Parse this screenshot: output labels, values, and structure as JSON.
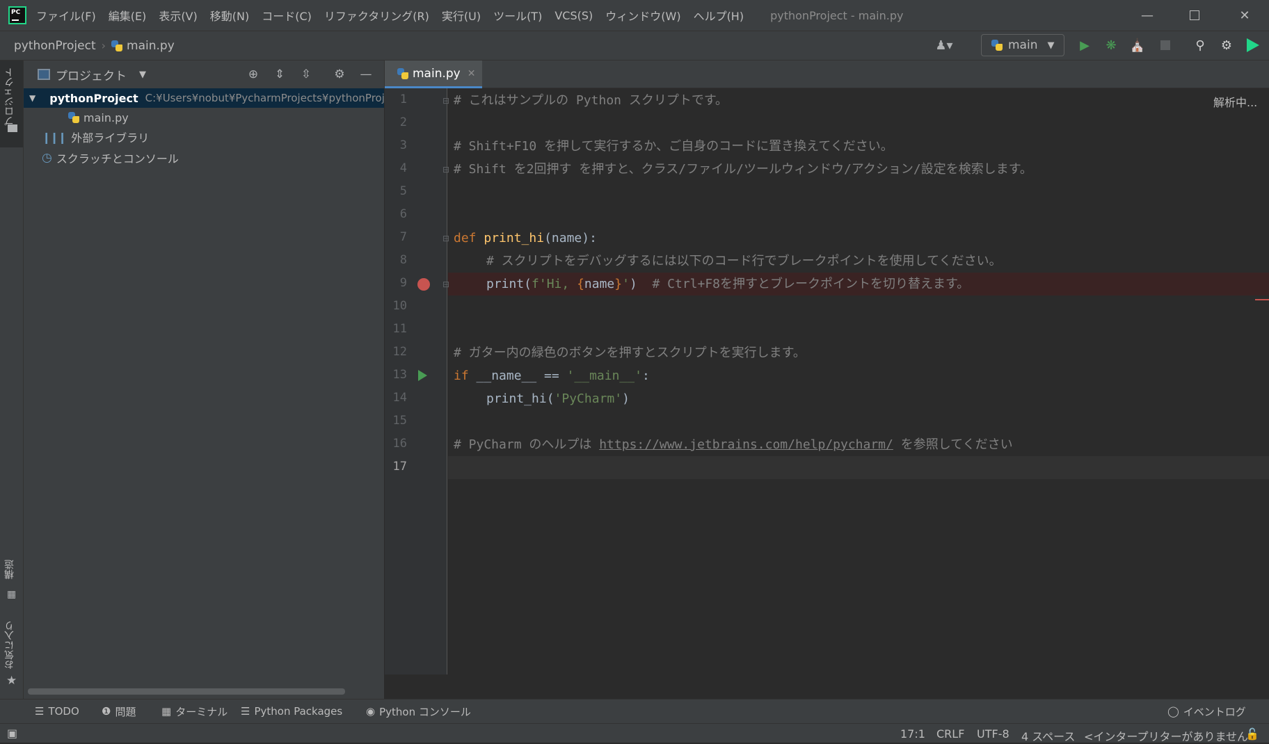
{
  "app": {
    "window_title": "pythonProject - main.py",
    "logo_text": "PC"
  },
  "menu": [
    "ファイル(F)",
    "編集(E)",
    "表示(V)",
    "移動(N)",
    "コード(C)",
    "リファクタリング(R)",
    "実行(U)",
    "ツール(T)",
    "VCS(S)",
    "ウィンドウ(W)",
    "ヘルプ(H)"
  ],
  "breadcrumb": {
    "project": "pythonProject",
    "file": "main.py"
  },
  "run_config": {
    "name": "main"
  },
  "left_stripe": {
    "project_tab": "プロジェクト",
    "structure_tab": "構造",
    "favorites_tab": "お気に入り"
  },
  "project_panel": {
    "title": "プロジェクト",
    "tree": {
      "root_name": "pythonProject",
      "root_path": "C:¥Users¥nobut¥PycharmProjects¥pythonProject",
      "file": "main.py",
      "external_libs": "外部ライブラリ",
      "scratches": "スクラッチとコンソール"
    }
  },
  "editor": {
    "tab_label": "main.py",
    "status": "解析中...",
    "current_line": 17,
    "breakpoint_line": 9,
    "run_gutter_line": 13,
    "lines": {
      "l1": "# これはサンプルの Python スクリプトです。",
      "l3": "# Shift+F10 を押して実行するか、ご自身のコードに置き換えてください。",
      "l4": "# Shift を2回押す を押すと、クラス/ファイル/ツールウィンドウ/アクション/設定を検索します。",
      "l7_kw": "def",
      "l7_fn": "print_hi",
      "l7_rest": "(name):",
      "l8": "# スクリプトをデバッグするには以下のコード行でブレークポイントを使用してください。",
      "l9_a": "print(",
      "l9_b": "f'Hi, ",
      "l9_c": "{",
      "l9_d": "name",
      "l9_e": "}",
      "l9_f": "'",
      "l9_g": ")",
      "l9_cmt": "# Ctrl+F8を押すとブレークポイントを切り替えます。",
      "l12": "# ガター内の緑色のボタンを押すとスクリプトを実行します。",
      "l13_kw": "if",
      "l13_a": " __name__ == ",
      "l13_str": "'__main__'",
      "l13_b": ":",
      "l14_a": "print_hi(",
      "l14_str": "'PyCharm'",
      "l14_b": ")",
      "l16_a": "# PyCharm のヘルプは ",
      "l16_link": "https://www.jetbrains.com/help/pycharm/",
      "l16_b": " を参照してください"
    }
  },
  "bottom_tools": {
    "todo": "TODO",
    "problems": "問題",
    "terminal": "ターミナル",
    "python_packages": "Python Packages",
    "python_console": "Python コンソール",
    "event_log": "イベントログ"
  },
  "status_bar": {
    "position": "17:1",
    "line_sep": "CRLF",
    "encoding": "UTF-8",
    "indent": "4 スペース",
    "interpreter": "<インタープリターがありません>"
  },
  "colors": {
    "bg": "#2b2b2b",
    "panel": "#3c3f41",
    "comment": "#808080",
    "keyword": "#cc7832",
    "function": "#ffc66d",
    "string": "#6a8759",
    "run_green": "#499c54",
    "breakpoint_red": "#c75450",
    "selection": "#0d293e"
  }
}
